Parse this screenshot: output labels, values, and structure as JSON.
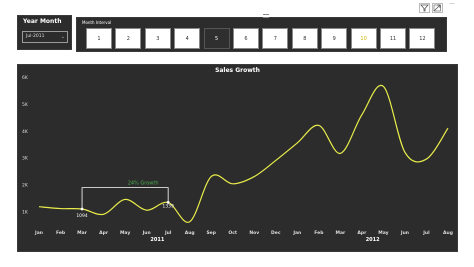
{
  "slicer": {
    "title": "Year Month",
    "selected": "Jul-2011"
  },
  "month_interval": {
    "title": "Month Interval",
    "buttons": [
      "1",
      "2",
      "3",
      "4",
      "5",
      "6",
      "7",
      "8",
      "9",
      "10",
      "11",
      "12"
    ],
    "selected_label": "5",
    "highlighted_label": "10"
  },
  "toolbar": {
    "filter_icon": "filter-icon",
    "focus_icon": "focus-mode-icon",
    "more_label": "..."
  },
  "colors": {
    "panel": "#2c2c2c",
    "line": "#e8ec4a",
    "annotation": "#4caf50",
    "text": "#ffffff"
  },
  "chart_data": {
    "type": "line",
    "title": "Sales Growth",
    "ylim": [
      500,
      6000
    ],
    "yticks": [
      1000,
      2000,
      3000,
      4000,
      5000,
      6000
    ],
    "ytick_labels": [
      "1K",
      "2K",
      "3K",
      "4K",
      "5K",
      "6K"
    ],
    "categories": [
      "Jan",
      "Feb",
      "Mar",
      "Apr",
      "May",
      "Jun",
      "Jul",
      "Aug",
      "Sep",
      "Oct",
      "Nov",
      "Dec",
      "Jan",
      "Feb",
      "Mar",
      "Apr",
      "May",
      "Jun",
      "Jul",
      "Aug"
    ],
    "year_labels": [
      {
        "label": "2011",
        "at_index": 5.5
      },
      {
        "label": "2012",
        "at_index": 15.5
      }
    ],
    "series": [
      {
        "values": [
          1180,
          1110,
          1094,
          900,
          1450,
          1050,
          1339,
          620,
          2300,
          2030,
          2300,
          2900,
          3550,
          4200,
          3160,
          4600,
          5650,
          3200,
          2950,
          4100
        ]
      }
    ],
    "annotation": {
      "text": "24% Growth",
      "from_index": 2,
      "to_index": 6,
      "from_label": "1094",
      "to_label": "1339"
    },
    "grid": false,
    "legend": "none"
  }
}
